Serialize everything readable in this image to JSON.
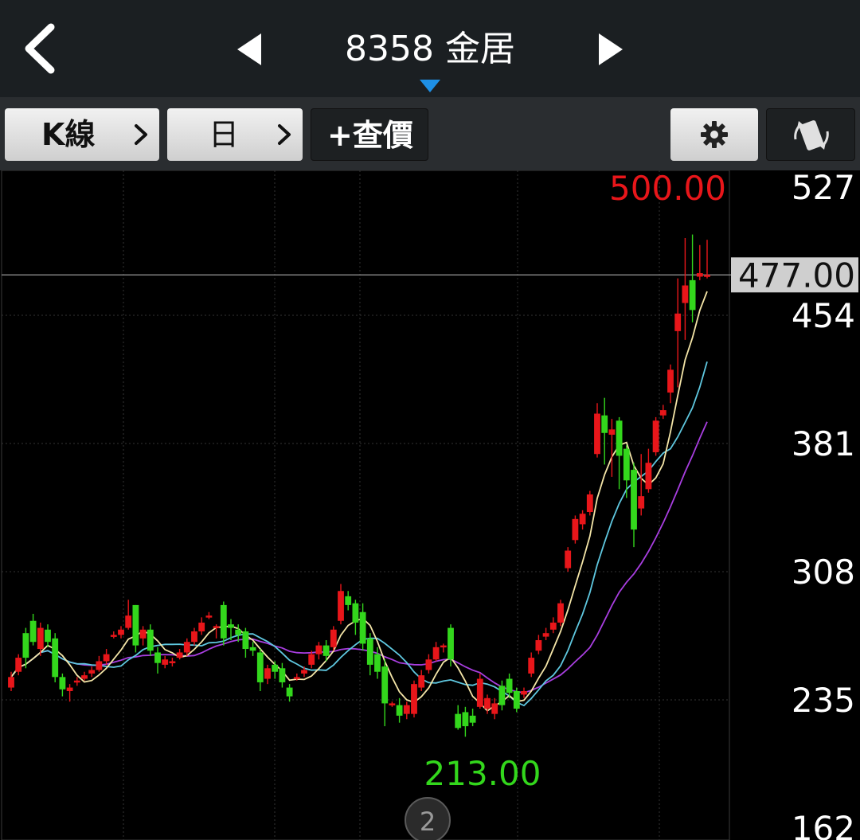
{
  "header": {
    "title": "8358 金居"
  },
  "toolbar": {
    "kline_label": "K線",
    "period_label": "日",
    "query_label": "+查價"
  },
  "chart_data": {
    "type": "candlestick",
    "y_ticks": [
      "527",
      "454",
      "381",
      "308",
      "235",
      "162"
    ],
    "ylim": [
      162,
      527
    ],
    "current_price_label": "477.00",
    "current_price": 477,
    "high_label": "500.00",
    "low_label": "213.00",
    "page_indicator": "2",
    "colors": {
      "up": "#e8161a",
      "down": "#33d71c",
      "ma5": "#f5e6a8",
      "ma10": "#5fc8e0",
      "ma20": "#a83ee0",
      "high": "#e8161a",
      "low": "#33d71c"
    },
    "candles": [
      {
        "o": 242,
        "c": 248,
        "h": 251,
        "l": 240
      },
      {
        "o": 251,
        "c": 259,
        "h": 261,
        "l": 249
      },
      {
        "o": 273,
        "c": 259,
        "h": 276,
        "l": 253
      },
      {
        "o": 280,
        "c": 268,
        "h": 284,
        "l": 266
      },
      {
        "o": 264,
        "c": 276,
        "h": 279,
        "l": 260
      },
      {
        "o": 275,
        "c": 268,
        "h": 278,
        "l": 265
      },
      {
        "o": 270,
        "c": 248,
        "h": 273,
        "l": 245
      },
      {
        "o": 248,
        "c": 241,
        "h": 250,
        "l": 237
      },
      {
        "o": 240,
        "c": 242,
        "h": 244,
        "l": 234
      },
      {
        "o": 245,
        "c": 246,
        "h": 248,
        "l": 243
      },
      {
        "o": 247,
        "c": 249,
        "h": 251,
        "l": 246
      },
      {
        "o": 250,
        "c": 252,
        "h": 254,
        "l": 248
      },
      {
        "o": 252,
        "c": 257,
        "h": 260,
        "l": 251
      },
      {
        "o": 257,
        "c": 261,
        "h": 264,
        "l": 255
      },
      {
        "o": 272,
        "c": 272,
        "h": 274,
        "l": 270
      },
      {
        "o": 272,
        "c": 275,
        "h": 277,
        "l": 270
      },
      {
        "o": 276,
        "c": 283,
        "h": 292,
        "l": 275
      },
      {
        "o": 289,
        "c": 266,
        "h": 289,
        "l": 262
      },
      {
        "o": 270,
        "c": 275,
        "h": 277,
        "l": 266
      },
      {
        "o": 275,
        "c": 263,
        "h": 278,
        "l": 260
      },
      {
        "o": 262,
        "c": 256,
        "h": 265,
        "l": 250
      },
      {
        "o": 255,
        "c": 258,
        "h": 260,
        "l": 253
      },
      {
        "o": 257,
        "c": 257,
        "h": 259,
        "l": 254
      },
      {
        "o": 259,
        "c": 262,
        "h": 264,
        "l": 258
      },
      {
        "o": 262,
        "c": 268,
        "h": 270,
        "l": 260
      },
      {
        "o": 268,
        "c": 274,
        "h": 276,
        "l": 266
      },
      {
        "o": 274,
        "c": 279,
        "h": 282,
        "l": 272
      },
      {
        "o": 283,
        "c": 283,
        "h": 285,
        "l": 281
      },
      {
        "o": 277,
        "c": 277,
        "h": 278,
        "l": 270
      },
      {
        "o": 289,
        "c": 270,
        "h": 291,
        "l": 266
      },
      {
        "o": 278,
        "c": 276,
        "h": 281,
        "l": 269
      },
      {
        "o": 275,
        "c": 272,
        "h": 278,
        "l": 268
      },
      {
        "o": 274,
        "c": 264,
        "h": 276,
        "l": 259
      },
      {
        "o": 265,
        "c": 263,
        "h": 268,
        "l": 260
      },
      {
        "o": 262,
        "c": 245,
        "h": 264,
        "l": 240
      },
      {
        "o": 247,
        "c": 253,
        "h": 255,
        "l": 244
      },
      {
        "o": 255,
        "c": 251,
        "h": 257,
        "l": 247
      },
      {
        "o": 253,
        "c": 245,
        "h": 256,
        "l": 242
      },
      {
        "o": 242,
        "c": 237,
        "h": 244,
        "l": 234
      },
      {
        "o": 248,
        "c": 248,
        "h": 250,
        "l": 246
      },
      {
        "o": 250,
        "c": 252,
        "h": 254,
        "l": 248
      },
      {
        "o": 255,
        "c": 261,
        "h": 263,
        "l": 253
      },
      {
        "o": 261,
        "c": 266,
        "h": 268,
        "l": 258
      },
      {
        "o": 266,
        "c": 260,
        "h": 269,
        "l": 257
      },
      {
        "o": 265,
        "c": 275,
        "h": 277,
        "l": 263
      },
      {
        "o": 280,
        "c": 297,
        "h": 301,
        "l": 278
      },
      {
        "o": 294,
        "c": 289,
        "h": 297,
        "l": 286
      },
      {
        "o": 290,
        "c": 279,
        "h": 292,
        "l": 272
      },
      {
        "o": 285,
        "c": 267,
        "h": 290,
        "l": 263
      },
      {
        "o": 270,
        "c": 255,
        "h": 273,
        "l": 249
      },
      {
        "o": 261,
        "c": 251,
        "h": 265,
        "l": 247
      },
      {
        "o": 254,
        "c": 233,
        "h": 258,
        "l": 220
      },
      {
        "o": 233,
        "c": 233,
        "h": 234,
        "l": 231
      },
      {
        "o": 232,
        "c": 226,
        "h": 236,
        "l": 222
      },
      {
        "o": 227,
        "c": 232,
        "h": 234,
        "l": 224
      },
      {
        "o": 227,
        "c": 244,
        "h": 246,
        "l": 225
      },
      {
        "o": 242,
        "c": 249,
        "h": 252,
        "l": 240
      },
      {
        "o": 252,
        "c": 258,
        "h": 261,
        "l": 250
      },
      {
        "o": 258,
        "c": 265,
        "h": 268,
        "l": 257
      },
      {
        "o": 265,
        "c": 266,
        "h": 267,
        "l": 262
      },
      {
        "o": 276,
        "c": 258,
        "h": 278,
        "l": 254
      },
      {
        "o": 227,
        "c": 219,
        "h": 232,
        "l": 218
      },
      {
        "o": 228,
        "c": 220,
        "h": 231,
        "l": 214
      },
      {
        "o": 226,
        "c": 222,
        "h": 230,
        "l": 220
      },
      {
        "o": 231,
        "c": 247,
        "h": 250,
        "l": 230
      },
      {
        "o": 230,
        "c": 236,
        "h": 238,
        "l": 227
      },
      {
        "o": 227,
        "c": 233,
        "h": 236,
        "l": 224
      },
      {
        "o": 243,
        "c": 232,
        "h": 246,
        "l": 229
      },
      {
        "o": 247,
        "c": 239,
        "h": 250,
        "l": 236
      },
      {
        "o": 240,
        "c": 230,
        "h": 242,
        "l": 228
      },
      {
        "o": 238,
        "c": 240,
        "h": 242,
        "l": 236
      },
      {
        "o": 250,
        "c": 259,
        "h": 262,
        "l": 248
      },
      {
        "o": 263,
        "c": 269,
        "h": 272,
        "l": 261
      },
      {
        "o": 271,
        "c": 273,
        "h": 276,
        "l": 269
      },
      {
        "o": 275,
        "c": 279,
        "h": 282,
        "l": 273
      },
      {
        "o": 279,
        "c": 290,
        "h": 292,
        "l": 277
      },
      {
        "o": 310,
        "c": 320,
        "h": 322,
        "l": 308
      },
      {
        "o": 326,
        "c": 338,
        "h": 340,
        "l": 324
      },
      {
        "o": 335,
        "c": 341,
        "h": 343,
        "l": 332
      },
      {
        "o": 342,
        "c": 352,
        "h": 354,
        "l": 340
      },
      {
        "o": 375,
        "c": 398,
        "h": 404,
        "l": 373
      },
      {
        "o": 397,
        "c": 387,
        "h": 407,
        "l": 369
      },
      {
        "o": 386,
        "c": 389,
        "h": 395,
        "l": 362
      },
      {
        "o": 394,
        "c": 374,
        "h": 396,
        "l": 355
      },
      {
        "o": 378,
        "c": 360,
        "h": 380,
        "l": 350
      },
      {
        "o": 366,
        "c": 332,
        "h": 370,
        "l": 322
      },
      {
        "o": 344,
        "c": 351,
        "h": 375,
        "l": 340
      },
      {
        "o": 355,
        "c": 370,
        "h": 378,
        "l": 353
      },
      {
        "o": 376,
        "c": 394,
        "h": 396,
        "l": 374
      },
      {
        "o": 397,
        "c": 400,
        "h": 403,
        "l": 395
      },
      {
        "o": 410,
        "c": 423,
        "h": 426,
        "l": 404
      },
      {
        "o": 445,
        "c": 455,
        "h": 475,
        "l": 413
      },
      {
        "o": 461,
        "c": 471,
        "h": 498,
        "l": 440
      },
      {
        "o": 474,
        "c": 457,
        "h": 500,
        "l": 450
      },
      {
        "o": 476,
        "c": 478,
        "h": 494,
        "l": 474
      },
      {
        "o": 477,
        "c": 477,
        "h": 497,
        "l": 475
      }
    ]
  }
}
